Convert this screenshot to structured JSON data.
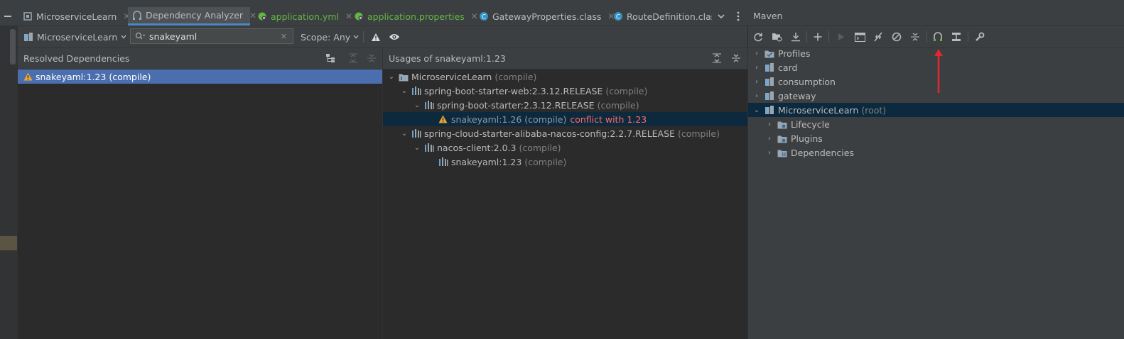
{
  "tabs": [
    {
      "label": "MicroserviceLearn",
      "icon": "module-icon"
    },
    {
      "label": "Dependency Analyzer",
      "icon": "dependency-analyzer-icon",
      "active": true
    },
    {
      "label": "application.yml",
      "icon": "spring-config-icon"
    },
    {
      "label": "application.properties",
      "icon": "spring-config-icon"
    },
    {
      "label": "GatewayProperties.class",
      "icon": "class-icon"
    },
    {
      "label": "RouteDefinition.class",
      "icon": "class-icon"
    }
  ],
  "toolbar": {
    "module_selector": "MicroserviceLearn",
    "search_value": "snakeyaml",
    "scope_label": "Scope: Any"
  },
  "resolved": {
    "header": "Resolved Dependencies",
    "items": [
      {
        "name": "snakeyaml:1.23",
        "scope": "(compile)",
        "warning": true
      }
    ]
  },
  "usages": {
    "header": "Usages of snakeyaml:1.23",
    "rows": [
      {
        "label": "MicroserviceLearn",
        "scope": "(compile)"
      },
      {
        "label": "spring-boot-starter-web:2.3.12.RELEASE",
        "scope": "(compile)"
      },
      {
        "label": "spring-boot-starter:2.3.12.RELEASE",
        "scope": "(compile)"
      },
      {
        "label": "snakeyaml:1.26 (compile)",
        "scope": "",
        "conflict": "conflict with 1.23"
      },
      {
        "label": "spring-cloud-starter-alibaba-nacos-config:2.2.7.RELEASE",
        "scope": "(compile)"
      },
      {
        "label": "nacos-client:2.0.3",
        "scope": "(compile)"
      },
      {
        "label": "snakeyaml:1.23",
        "scope": "(compile)"
      }
    ]
  },
  "maven": {
    "title": "Maven",
    "tree": [
      {
        "label": "Profiles",
        "suffix": ""
      },
      {
        "label": "card",
        "suffix": ""
      },
      {
        "label": "consumption",
        "suffix": ""
      },
      {
        "label": "gateway",
        "suffix": ""
      },
      {
        "label": "MicroserviceLearn",
        "suffix": "(root)"
      },
      {
        "label": "Lifecycle",
        "suffix": ""
      },
      {
        "label": "Plugins",
        "suffix": ""
      },
      {
        "label": "Dependencies",
        "suffix": ""
      }
    ]
  },
  "colors": {
    "accent": "#4a88c7",
    "selection": "#4b6eaf",
    "conflict": "#ff6b68",
    "annotation_arrow": "#e0282e"
  }
}
